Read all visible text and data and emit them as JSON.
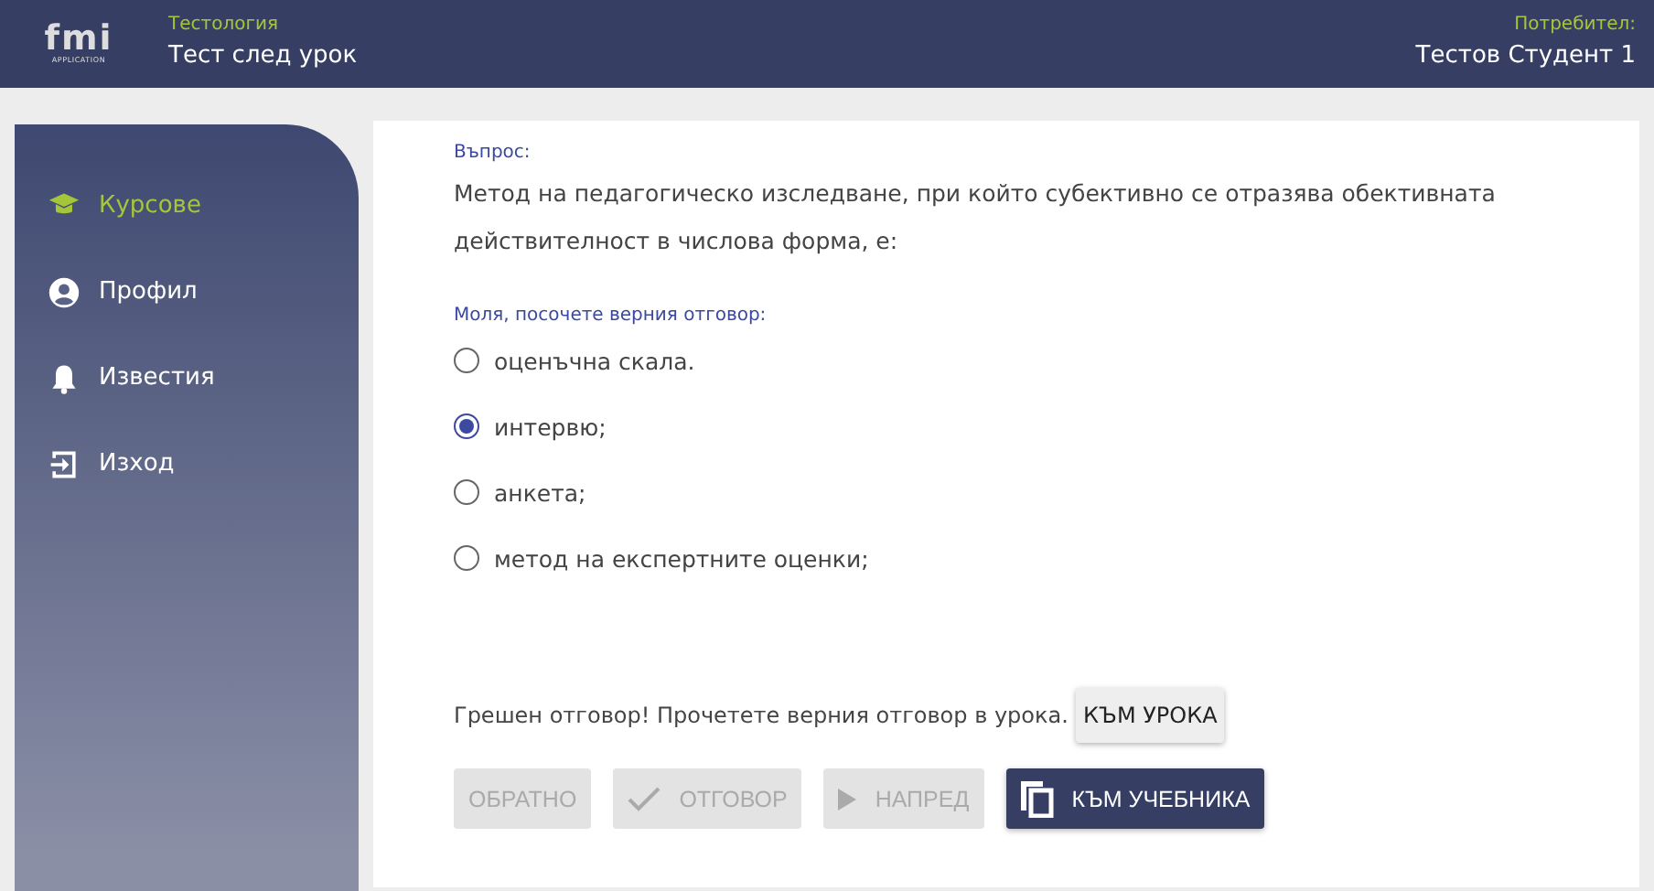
{
  "header": {
    "logo": {
      "mark": "fmi",
      "caption": "APPLICATION"
    },
    "subtitle": "Тестология",
    "title": "Тест след урок",
    "user_label": "Потребител:",
    "user_name": "Тестов Студент 1"
  },
  "sidebar": {
    "items": [
      {
        "label": "Курсове",
        "kind": "cap",
        "selected": true
      },
      {
        "label": "Профил",
        "kind": "user",
        "selected": false
      },
      {
        "label": "Известия",
        "kind": "bell",
        "selected": false
      },
      {
        "label": "Изход",
        "kind": "exit",
        "selected": false
      }
    ]
  },
  "question": {
    "label": "Въпрос:",
    "text": "Метод на педагогическо изследване, при който субективно се отразява обективната действителност в числова форма, е:"
  },
  "answers": {
    "prompt": "Моля, посочете верния отговор:",
    "options": [
      {
        "label": "оценъчна скала.",
        "selected": false
      },
      {
        "label": "интервю;",
        "selected": true
      },
      {
        "label": "анкета;",
        "selected": false
      },
      {
        "label": "метод на експертните оценки;",
        "selected": false
      }
    ]
  },
  "feedback": {
    "message": "Грешен отговор! Прочетете верния отговор в урока.",
    "button": "КЪМ УРОКА"
  },
  "buttons": [
    {
      "label": "ОБРАТНО",
      "kind": "plain",
      "disabled": true
    },
    {
      "label": "ОТГОВОР",
      "kind": "check",
      "disabled": true
    },
    {
      "label": "НАПРЕД",
      "kind": "play",
      "disabled": true
    },
    {
      "label": "КЪМ УЧЕБНИКА",
      "kind": "copy",
      "disabled": false
    }
  ]
}
